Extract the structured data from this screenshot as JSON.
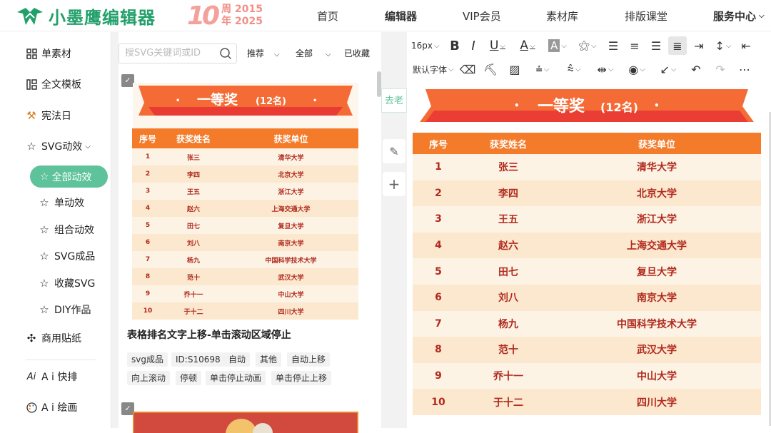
{
  "brand": {
    "name": "小墨鹰编辑器",
    "anniversary_number": "10",
    "anniversary_label": "周",
    "anniversary_label2": "年",
    "anniversary_years_from": "2015",
    "anniversary_years_to": "2025",
    "color": "#22a06b"
  },
  "nav": [
    {
      "label": "首页"
    },
    {
      "label": "编辑器"
    },
    {
      "label": "VIP会员"
    },
    {
      "label": "素材库"
    },
    {
      "label": "排版课堂"
    },
    {
      "label": "服务中心"
    }
  ],
  "sidebar": {
    "items": [
      {
        "label": "单素材",
        "icon": "grid-icon"
      },
      {
        "label": "全文模板",
        "icon": "template-icon"
      },
      {
        "label": "宪法日",
        "icon": "gavel-icon"
      },
      {
        "label": "SVG动效",
        "icon": "star-icon"
      },
      {
        "label": "全部动效",
        "icon": "star-icon"
      },
      {
        "label": "单动效",
        "icon": "star-icon"
      },
      {
        "label": "组合动效",
        "icon": "star-icon"
      },
      {
        "label": "SVG成品",
        "icon": "star-icon"
      },
      {
        "label": "收藏SVG",
        "icon": "star-icon"
      },
      {
        "label": "DIY作品",
        "icon": "star-icon"
      },
      {
        "label": "商用贴纸",
        "icon": "puzzle-icon"
      },
      {
        "label": "A i 快排",
        "icon": "ai-icon"
      },
      {
        "label": "A i 绘画",
        "icon": "palette-icon"
      }
    ],
    "accent": "#5ec29a"
  },
  "library": {
    "search_placeholder": "搜SVG关键词或ID",
    "filters": [
      {
        "label": "推荐"
      },
      {
        "label": "全部"
      },
      {
        "label": "已收藏"
      }
    ],
    "item_title": "表格排名文字上移-单击滚动区域停止",
    "tags": [
      "svg成品",
      "ID:S10698",
      "自动",
      "其他",
      "自动上移",
      "向上滚动",
      "停顿",
      "单击停止动画",
      "单击停止上移"
    ]
  },
  "side_tools": {
    "go_label": "去老"
  },
  "toolbar": {
    "font_size": "16px",
    "font_family": "默认字体"
  },
  "award": {
    "title": "一等奖",
    "count": "(12名)",
    "headers": [
      "序号",
      "获奖姓名",
      "获奖单位"
    ],
    "rows": [
      {
        "no": "1",
        "name": "张三",
        "unit": "清华大学"
      },
      {
        "no": "2",
        "name": "李四",
        "unit": "北京大学"
      },
      {
        "no": "3",
        "name": "王五",
        "unit": "浙江大学"
      },
      {
        "no": "4",
        "name": "赵六",
        "unit": "上海交通大学"
      },
      {
        "no": "5",
        "name": "田七",
        "unit": "复旦大学"
      },
      {
        "no": "6",
        "name": "刘八",
        "unit": "南京大学"
      },
      {
        "no": "7",
        "name": "杨九",
        "unit": "中国科学技术大学"
      },
      {
        "no": "8",
        "name": "范十",
        "unit": "武汉大学"
      },
      {
        "no": "9",
        "name": "乔十一",
        "unit": "中山大学"
      },
      {
        "no": "10",
        "name": "于十二",
        "unit": "四川大学"
      }
    ],
    "colors": {
      "header": "#f47b2a",
      "row_a": "#fdf3e4",
      "row_b": "#fbe8cf",
      "text": "#b02a1e",
      "banner": "#ef4b35"
    }
  }
}
